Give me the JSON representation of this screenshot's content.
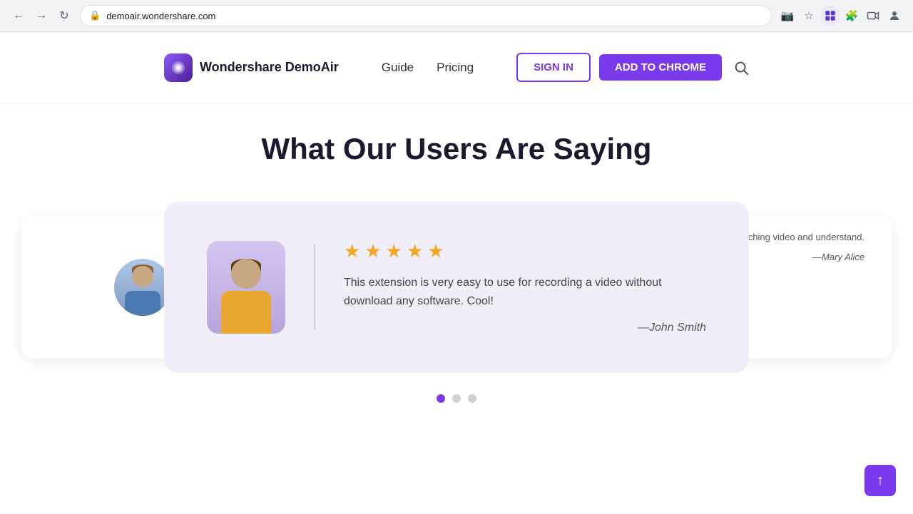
{
  "browser": {
    "url": "demoair.wondershare.com",
    "back_tooltip": "Back",
    "forward_tooltip": "Forward",
    "reload_tooltip": "Reload"
  },
  "navbar": {
    "logo_text": "Wondershare DemoAir",
    "nav_items": [
      {
        "label": "Guide",
        "id": "guide"
      },
      {
        "label": "Pricing",
        "id": "pricing"
      }
    ],
    "sign_in_label": "SIGN IN",
    "add_chrome_label": "ADD TO CHROME"
  },
  "page": {
    "section_title": "What Our Users Are Saying",
    "testimonials": [
      {
        "id": 1,
        "stars": 5,
        "text": "This extension is very easy to use for recording a video without download any software. Cool!",
        "author": "—John Smith"
      },
      {
        "id": 2,
        "text": "reaching video and understand.",
        "author": "—Mary Alice"
      }
    ],
    "carousel_dots": [
      {
        "active": true
      },
      {
        "active": false
      },
      {
        "active": false
      }
    ]
  },
  "icons": {
    "back": "←",
    "forward": "→",
    "reload": "↻",
    "lock": "🔒",
    "star": "★",
    "search": "⌕",
    "scroll_up": "↑"
  }
}
